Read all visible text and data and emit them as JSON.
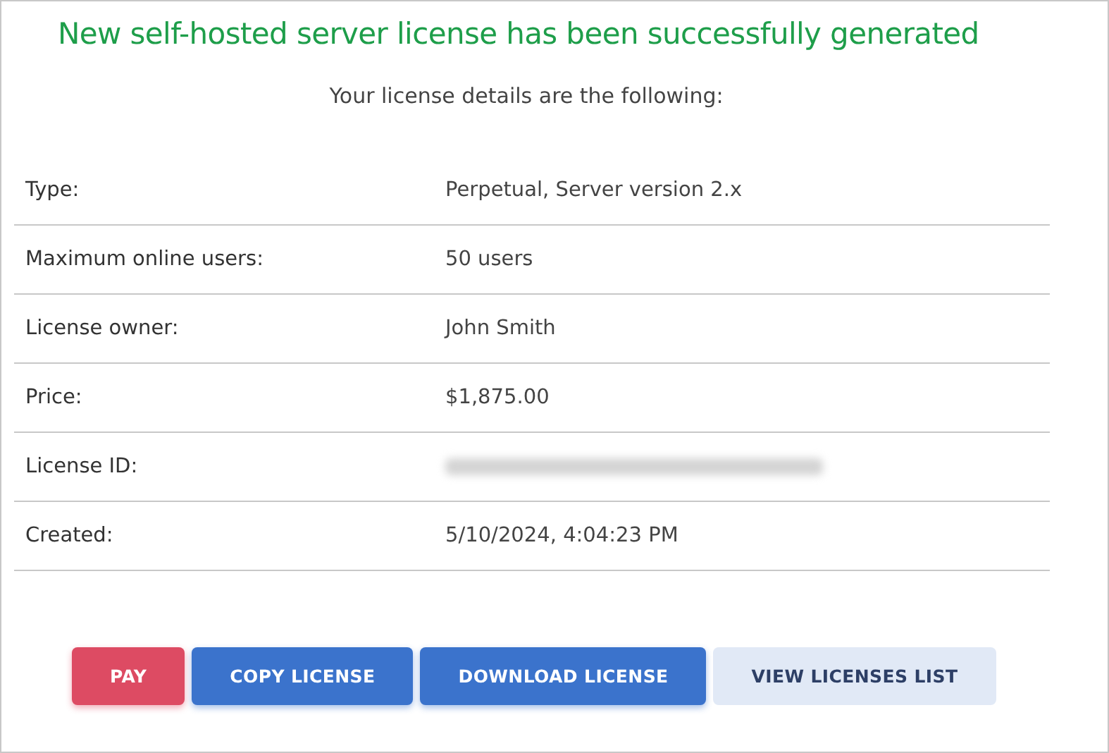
{
  "title": "New self-hosted server license has been successfully generated",
  "subtitle": "Your license details are the following:",
  "details": [
    {
      "label": "Type:",
      "value": "Perpetual, Server version 2.x",
      "redacted": false
    },
    {
      "label": "Maximum online users:",
      "value": "50 users",
      "redacted": false
    },
    {
      "label": "License owner:",
      "value": "John Smith",
      "redacted": false
    },
    {
      "label": "Price:",
      "value": "$1,875.00",
      "redacted": false
    },
    {
      "label": "License ID:",
      "redacted": true
    },
    {
      "label": "Created:",
      "value": "5/10/2024, 4:04:23 PM",
      "redacted": false
    }
  ],
  "buttons": [
    {
      "label": "PAY",
      "kind": "danger"
    },
    {
      "label": "COPY LICENSE",
      "kind": "primary"
    },
    {
      "label": "DOWNLOAD LICENSE",
      "kind": "primary"
    },
    {
      "label": "VIEW LICENSES LIST",
      "kind": "secondary"
    }
  ]
}
